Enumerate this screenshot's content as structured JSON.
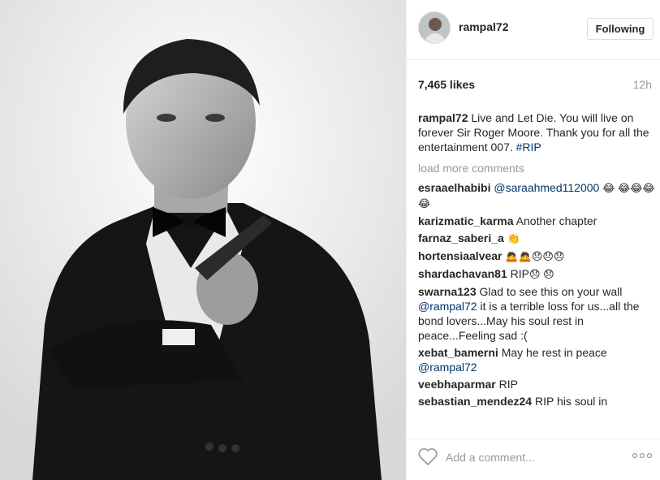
{
  "post": {
    "username": "rampal72",
    "follow_label": "Following",
    "likes": "7,465 likes",
    "time": "12h"
  },
  "caption": {
    "author": "rampal72",
    "text": "Live and Let Die. You will live on forever Sir Roger Moore. Thank you for all the entertainment 007.",
    "hashtag": "#RIP"
  },
  "load_more": "load more comments",
  "comments": [
    {
      "author": "esraaelhabibi",
      "mention": "@saraahmed112000",
      "text": "",
      "emoji": "😂 😂😂😂😂"
    },
    {
      "author": "karizmatic_karma",
      "text": "Another chapter"
    },
    {
      "author": "farnaz_saberi_a",
      "text": "",
      "emoji": "👏"
    },
    {
      "author": "hortensiaalvear",
      "text": "",
      "emoji": "🙇🙇😞😞😞"
    },
    {
      "author": "shardachavan81",
      "text": "RIP",
      "emoji": "😞 😞"
    },
    {
      "author": "swarna123",
      "text_before": "Glad to see this on your wall",
      "mention": "@rampal72",
      "text_after": "it is a terrible loss for us...all the bond lovers...May his soul rest in peace...Feeling sad :("
    },
    {
      "author": "xebat_bamerni",
      "text": "May he rest in peace",
      "mention": "@rampal72"
    },
    {
      "author": "veebhaparmar",
      "text": "RIP"
    },
    {
      "author": "sebastian_mendez24",
      "text": "RIP his soul in"
    }
  ],
  "footer": {
    "placeholder": "Add a comment..."
  }
}
